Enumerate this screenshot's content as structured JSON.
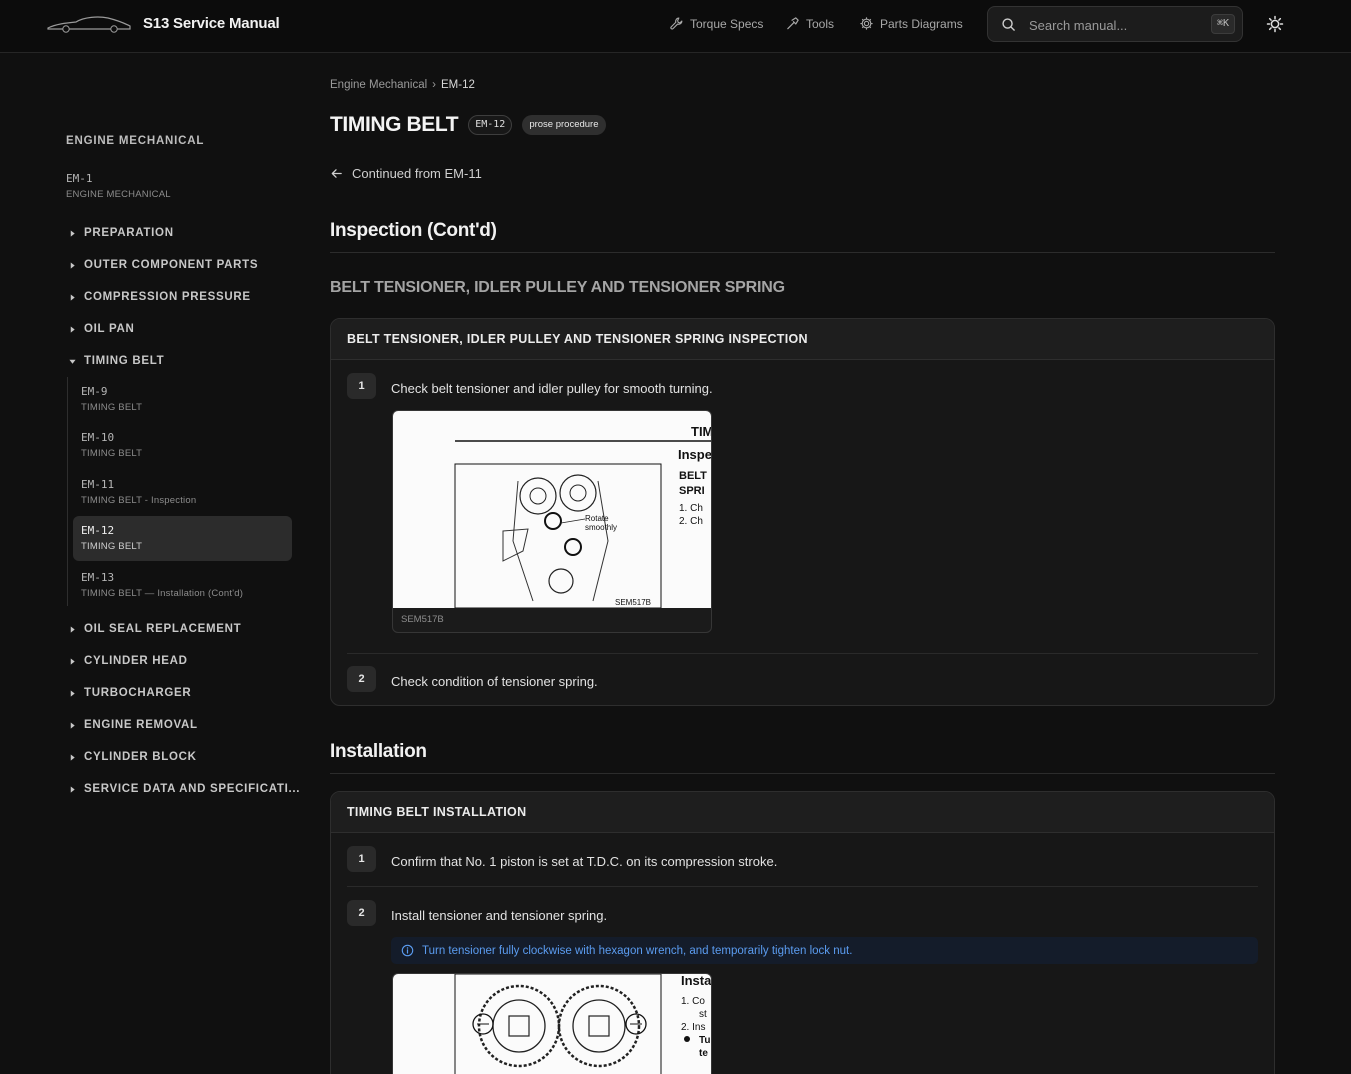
{
  "header": {
    "brand": "S13 Service Manual",
    "nav": [
      {
        "label": "Torque Specs",
        "icon": "wrench-icon"
      },
      {
        "label": "Tools",
        "icon": "hammer-icon"
      },
      {
        "label": "Parts Diagrams",
        "icon": "gear-icon"
      }
    ],
    "search_placeholder": "Search manual...",
    "search_shortcut": "⌘K",
    "theme_icon": "sun-icon"
  },
  "sidebar": {
    "heading": "ENGINE MECHANICAL",
    "top_item": {
      "code": "EM-1",
      "sub": "ENGINE MECHANICAL"
    },
    "sections": [
      {
        "label": "PREPARATION",
        "expanded": false
      },
      {
        "label": "OUTER COMPONENT PARTS",
        "expanded": false
      },
      {
        "label": "COMPRESSION PRESSURE",
        "expanded": false
      },
      {
        "label": "OIL PAN",
        "expanded": false
      },
      {
        "label": "TIMING BELT",
        "expanded": true
      },
      {
        "label": "OIL SEAL REPLACEMENT",
        "expanded": false
      },
      {
        "label": "CYLINDER HEAD",
        "expanded": false
      },
      {
        "label": "TURBOCHARGER",
        "expanded": false
      },
      {
        "label": "ENGINE REMOVAL",
        "expanded": false
      },
      {
        "label": "CYLINDER BLOCK",
        "expanded": false
      },
      {
        "label": "SERVICE DATA AND SPECIFICATI...",
        "expanded": false
      }
    ],
    "timing_belt_pages": [
      {
        "code": "EM-9",
        "sub": "TIMING BELT",
        "active": false
      },
      {
        "code": "EM-10",
        "sub": "TIMING BELT",
        "active": false
      },
      {
        "code": "EM-11",
        "sub": "TIMING BELT - Inspection",
        "active": false
      },
      {
        "code": "EM-12",
        "sub": "TIMING BELT",
        "active": true
      },
      {
        "code": "EM-13",
        "sub": "TIMING BELT — Installation (Cont'd)",
        "active": false
      }
    ]
  },
  "main": {
    "breadcrumb": [
      "Engine Mechanical",
      "EM-12"
    ],
    "breadcrumb_sep": "›",
    "title": "TIMING BELT",
    "page_code": "EM-12",
    "badge": "prose procedure",
    "continued": "Continued from EM-11",
    "sections": [
      {
        "heading": "Inspection (Cont'd)",
        "subheading": "BELT TENSIONER, IDLER PULLEY AND TENSIONER SPRING",
        "card_title": "BELT TENSIONER, IDLER PULLEY AND TENSIONER SPRING INSPECTION",
        "steps": [
          {
            "num": "1",
            "text": "Check belt tensioner and idler pulley for smooth turning.",
            "figure_caption": "SEM517B",
            "figure_label": "Rotate smoothly",
            "figure_code": "SEM517B",
            "figure_side": [
              "TIM",
              "Inspe",
              "BELT",
              "SPRI",
              "1.  Ch",
              "2.  Ch"
            ]
          },
          {
            "num": "2",
            "text": "Check condition of tensioner spring."
          }
        ]
      },
      {
        "heading": "Installation",
        "card_title": "TIMING BELT INSTALLATION",
        "steps": [
          {
            "num": "1",
            "text": "Confirm that No. 1 piston is set at T.D.C. on its compression stroke."
          },
          {
            "num": "2",
            "text": "Install tensioner and tensioner spring.",
            "note": "Turn tensioner fully clockwise with hexagon wrench, and temporarily tighten lock nut.",
            "figure_side": [
              "Insta",
              "1.  Co",
              "st",
              "2.  Ins",
              "Tu",
              "te"
            ]
          }
        ]
      }
    ]
  }
}
